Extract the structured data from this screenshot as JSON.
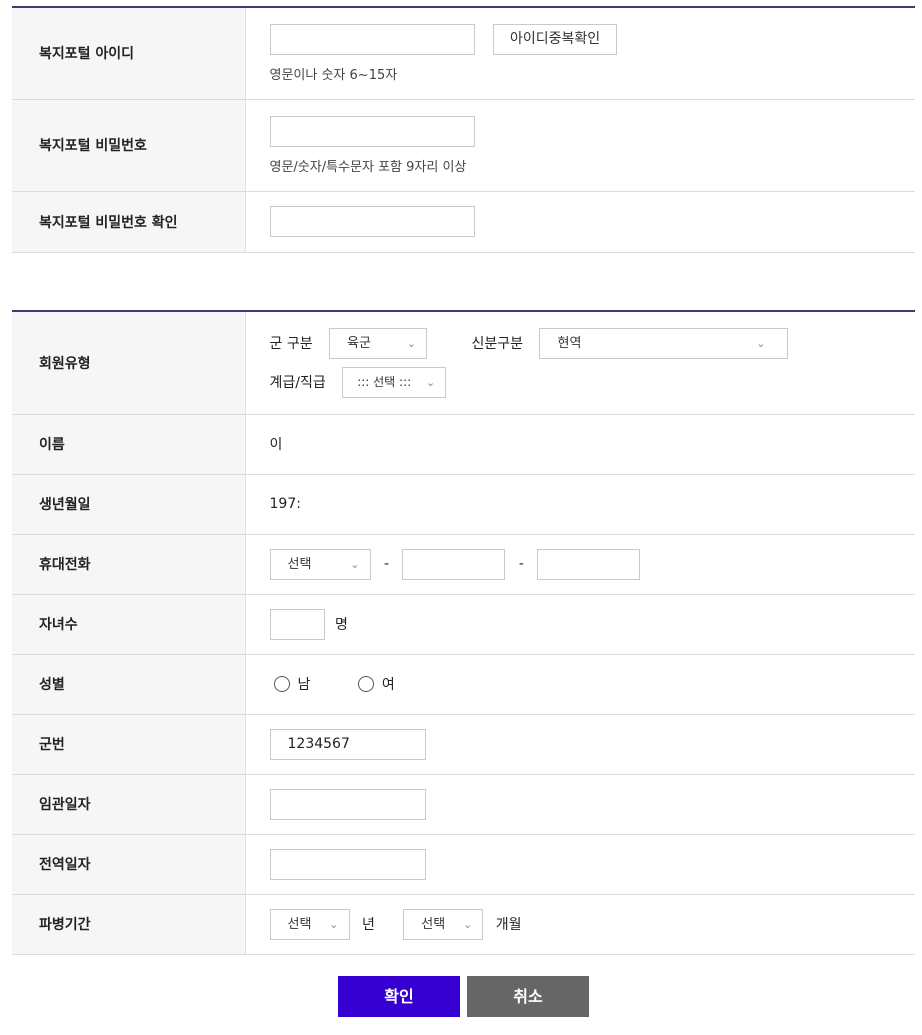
{
  "account": {
    "id_label": "복지포털 아이디",
    "id_value": "",
    "check_button": "아이디중복확인",
    "id_help": "영문이나 숫자 6~15자",
    "pw_label": "복지포털 비밀번호",
    "pw_value": "",
    "pw_help": "영문/숫자/특수문자 포함 9자리 이상",
    "pw_confirm_label": "복지포털 비밀번호 확인",
    "pw_confirm_value": ""
  },
  "member": {
    "type_label": "회원유형",
    "military_label": "군 구분",
    "military_value": "육군",
    "status_label": "신분구분",
    "status_value": "현역",
    "rank_label": "계급/직급",
    "rank_value": "::: 선택 :::",
    "name_label": "이름",
    "name_value": "이",
    "birth_label": "생년월일",
    "birth_value": "197:",
    "phone_label": "휴대전화",
    "phone_prefix": "선택",
    "phone_dash": "-",
    "phone_mid": "",
    "phone_last": "",
    "children_label": "자녀수",
    "children_value": "",
    "children_unit": "명",
    "gender_label": "성별",
    "gender_male": "남",
    "gender_female": "여",
    "service_no_label": "군번",
    "service_no_value": "1234567",
    "commission_label": "임관일자",
    "commission_value": "",
    "discharge_label": "전역일자",
    "discharge_value": "",
    "deploy_label": "파병기간",
    "deploy_year_value": "선택",
    "deploy_year_unit": "년",
    "deploy_month_value": "선택",
    "deploy_month_unit": "개월"
  },
  "actions": {
    "confirm": "확인",
    "cancel": "취소",
    "confirm_color": "#3700d2",
    "cancel_color": "#666666"
  },
  "icons": {
    "dropdown": "chevron-down-icon",
    "radio": "radio-empty-icon"
  }
}
